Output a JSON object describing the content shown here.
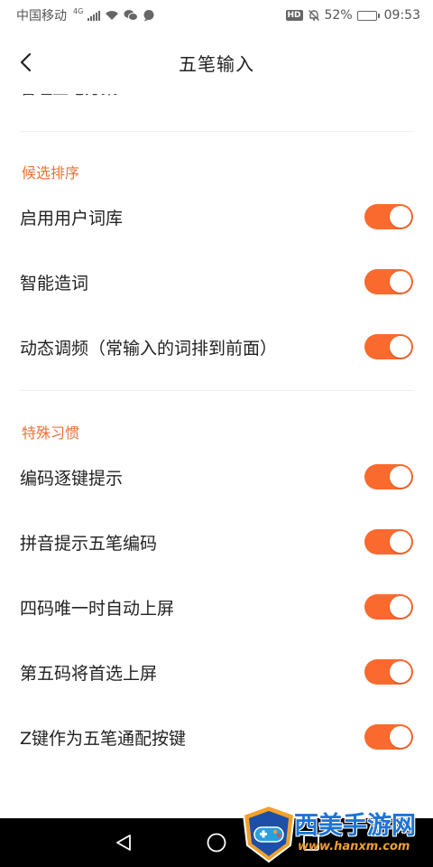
{
  "status_bar": {
    "carrier": "中国移动",
    "network": "4G",
    "battery_percent": "52%",
    "battery_level": 0.52,
    "time": "09:53",
    "hd_label": "HD"
  },
  "title_bar": {
    "title": "五笔输入"
  },
  "cut_row": {
    "label": "管理五笔方案"
  },
  "sections": [
    {
      "header": "候选排序",
      "items": [
        {
          "label": "启用用户词库",
          "on": true
        },
        {
          "label": "智能造词",
          "on": true
        },
        {
          "label": "动态调频（常输入的词排到前面）",
          "on": true
        }
      ]
    },
    {
      "header": "特殊习惯",
      "items": [
        {
          "label": "编码逐键提示",
          "on": true
        },
        {
          "label": "拼音提示五笔编码",
          "on": true
        },
        {
          "label": "四码唯一时自动上屏",
          "on": true
        },
        {
          "label": "第五码将首选上屏",
          "on": true
        },
        {
          "label": "Z键作为五笔通配按键",
          "on": true
        }
      ]
    }
  ],
  "watermark": {
    "name": "西美手游网",
    "url": "www.hanxm.com"
  },
  "colors": {
    "accent": "#ef7038",
    "toggle_on": "#fa6a2e"
  }
}
